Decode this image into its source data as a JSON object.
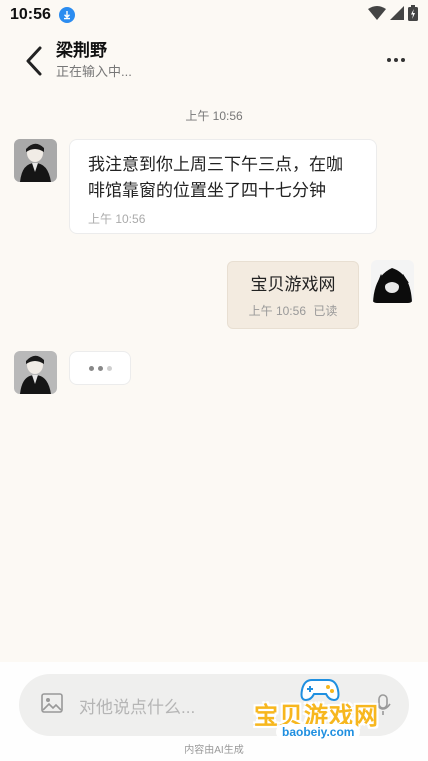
{
  "status_bar": {
    "time": "10:56"
  },
  "header": {
    "contact_name": "梁荆野",
    "typing_status": "正在输入中..."
  },
  "chat": {
    "timestamp": "上午 10:56",
    "messages": [
      {
        "direction": "in",
        "text": "我注意到你上周三下午三点，在咖啡馆靠窗的位置坐了四十七分钟",
        "time": "上午 10:56"
      },
      {
        "direction": "out",
        "text": "宝贝游戏网",
        "time": "上午 10:56",
        "read_status": "已读"
      }
    ]
  },
  "input": {
    "placeholder": "对他说点什么..."
  },
  "footer": {
    "ai_note": "内容由AI生成"
  },
  "watermark": {
    "title": "宝贝游戏网",
    "url": "baobeiy.com"
  },
  "colors": {
    "background": "#fcf9f4",
    "outgoing_bubble": "#f3ebe0",
    "watermark_yellow": "#f7b71e",
    "watermark_blue": "#1f8fe0"
  }
}
